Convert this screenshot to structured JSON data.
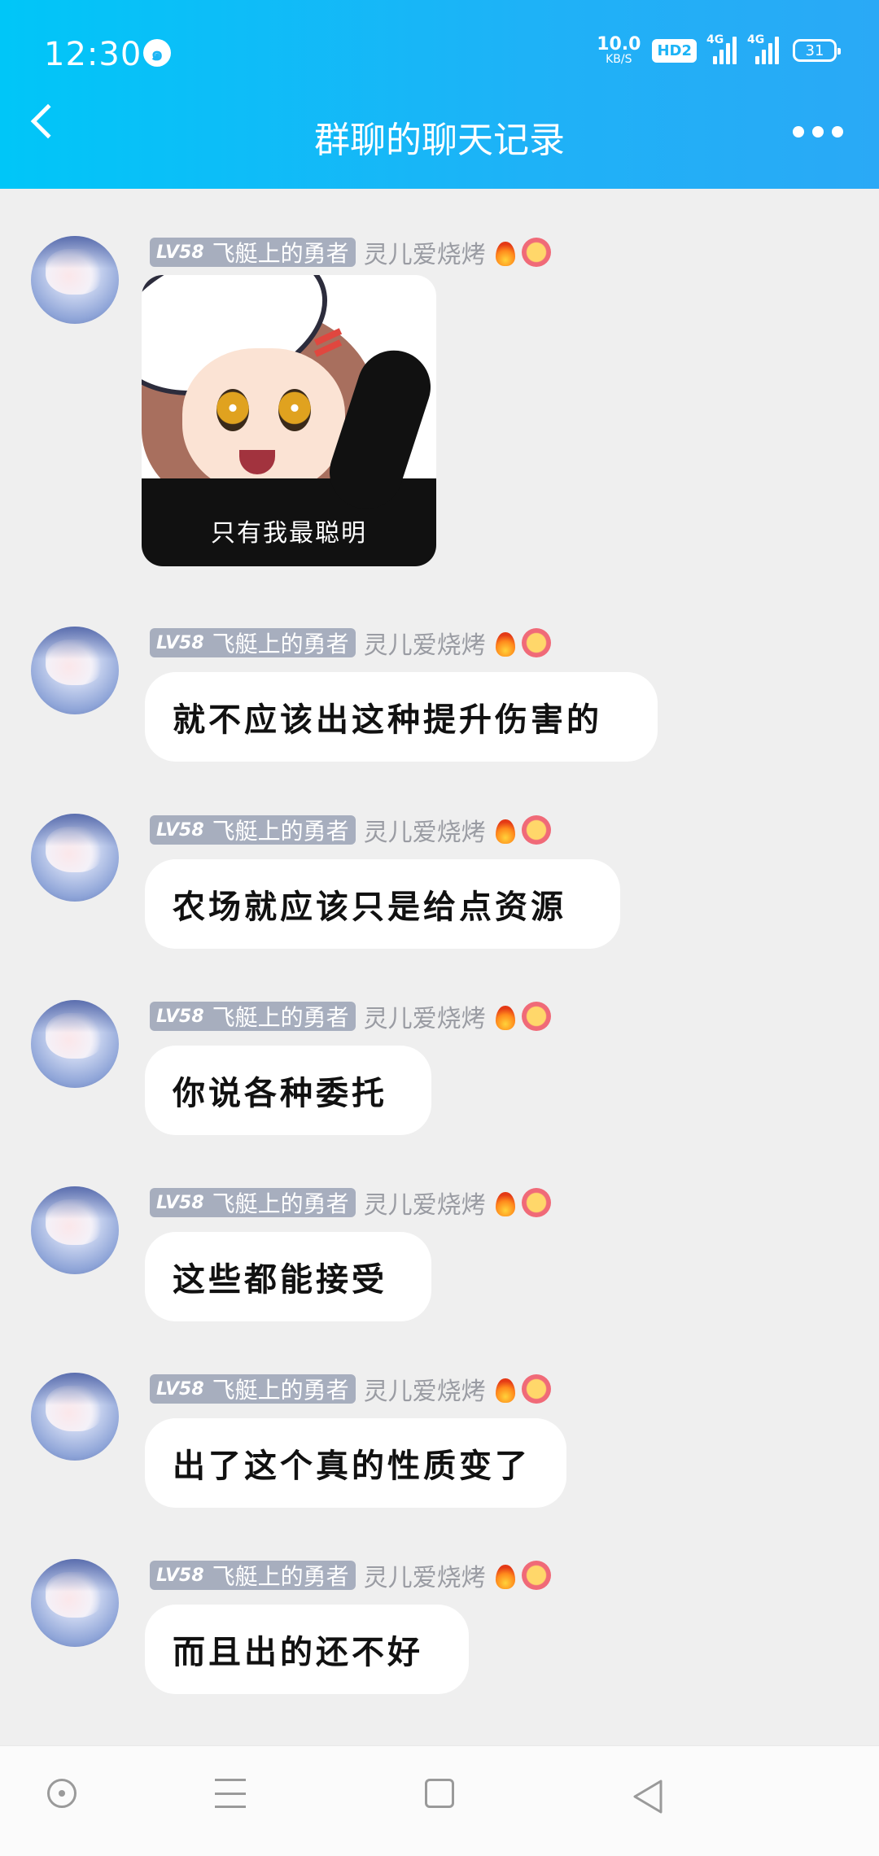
{
  "status_bar": {
    "time": "12:30",
    "net_speed_value": "10.0",
    "net_speed_unit": "KB/S",
    "hd_label": "HD2",
    "signal1_label": "4G",
    "signal2_label": "4G",
    "battery": "31"
  },
  "nav": {
    "title": "群聊的聊天记录"
  },
  "sender": {
    "level": "LV58",
    "title_badge": "飞艇上的勇者",
    "nickname": "灵儿爱烧烤"
  },
  "messages": [
    {
      "type": "sticker",
      "caption": "只有我最聪明"
    },
    {
      "type": "text",
      "text": "就不应该出这种提升伤害的"
    },
    {
      "type": "text",
      "text": "农场就应该只是给点资源"
    },
    {
      "type": "text",
      "text": "你说各种委托"
    },
    {
      "type": "text",
      "text": "这些都能接受"
    },
    {
      "type": "text",
      "text": "出了这个真的性质变了"
    },
    {
      "type": "text",
      "text": "而且出的还不好"
    }
  ],
  "colors": {
    "topbar_start": "#00c6f8",
    "topbar_end": "#2aa9f6",
    "chat_bg": "#efefef",
    "tag_bg": "#a7aebe"
  },
  "icons": [
    "back-arrow-icon",
    "more-dots-icon",
    "fire-icon",
    "flower-icon",
    "home-icon",
    "menu-icon",
    "recent-apps-icon",
    "back-triangle-icon"
  ]
}
